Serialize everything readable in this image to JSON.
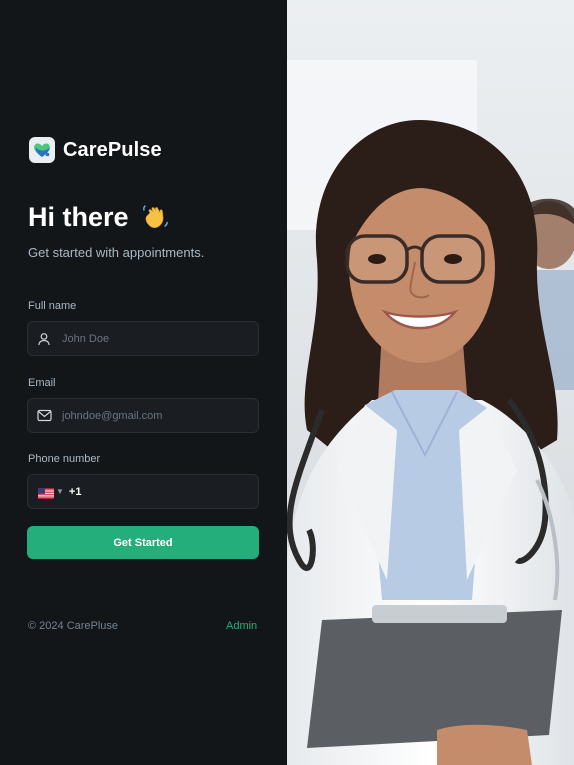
{
  "brand": {
    "name": "CarePulse",
    "logo_icon": "heart-stethoscope-icon"
  },
  "greeting": {
    "title": "Hi there",
    "emoji_icon": "waving-hand-icon"
  },
  "subtitle": "Get started with appointments.",
  "form": {
    "full_name": {
      "label": "Full name",
      "placeholder": "John Doe",
      "icon": "user-icon"
    },
    "email": {
      "label": "Email",
      "placeholder": "johndoe@gmail.com",
      "icon": "mail-icon"
    },
    "phone": {
      "label": "Phone number",
      "country_flag": "us-flag-icon",
      "value": "+1"
    },
    "submit_label": "Get Started"
  },
  "footer": {
    "copyright": "© 2024 CarePluse",
    "admin_link": "Admin"
  },
  "colors": {
    "background": "#131619",
    "accent": "#24ae7c",
    "input_bg": "#1a1d21",
    "muted_text": "#abb8c4"
  },
  "hero_image": {
    "subject": "doctor-photo"
  }
}
